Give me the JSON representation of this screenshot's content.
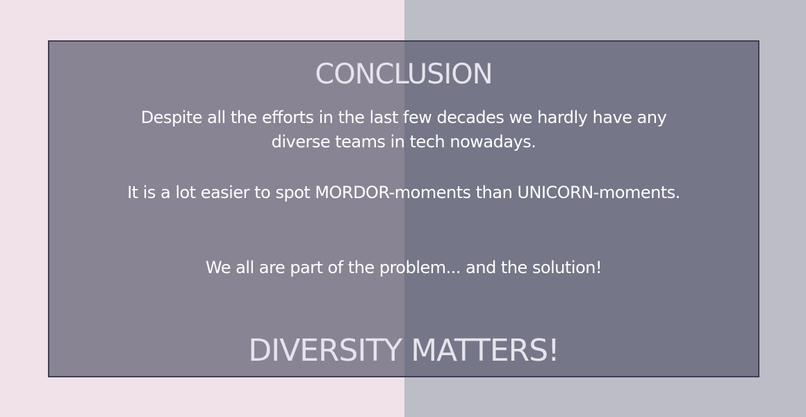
{
  "colors": {
    "background_left": "#f1e2ea",
    "background_right": "#bdbdc8",
    "panel_border": "#3e3e52",
    "title_text": "#e6e3ec",
    "body_text": "#ffffff"
  },
  "panel": {
    "title": "CONCLUSION",
    "paragraphs": [
      "Despite all the efforts in the last few decades we hardly have any diverse teams in tech nowadays.",
      "It is a lot easier to spot MORDOR-moments than UNICORN-moments.",
      "We all are part of the problem... and the solution!"
    ],
    "footer": "DIVERSITY MATTERS!"
  }
}
